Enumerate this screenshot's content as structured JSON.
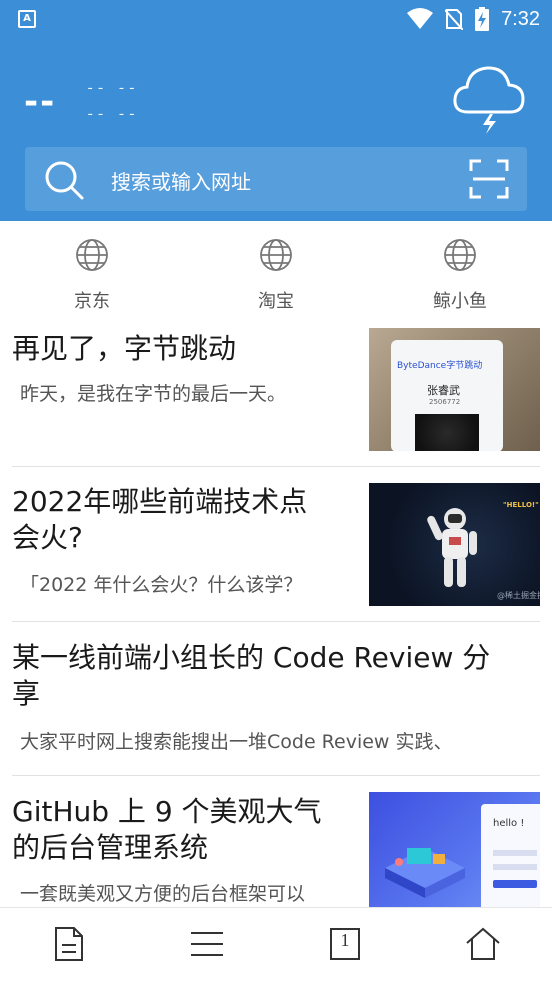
{
  "status": {
    "time": "7:32",
    "app_badge": "A"
  },
  "weather": {
    "temp": "--",
    "line1": "-- --",
    "line2": "-- --",
    "icon": "thunderstorm-cloud-icon"
  },
  "search": {
    "placeholder": "搜索或输入网址"
  },
  "quicklinks": [
    {
      "label": "京东",
      "icon": "globe-icon"
    },
    {
      "label": "淘宝",
      "icon": "globe-icon"
    },
    {
      "label": "鲸小鱼",
      "icon": "globe-icon"
    }
  ],
  "articles": [
    {
      "title_l1": "再见了，字节跳动",
      "title_l2": "",
      "summary": "昨天，是我在字节的最后一天。"
    },
    {
      "title_l1": "2022年哪些前端技术点",
      "title_l2": "会火?",
      "summary": "「2022 年什么会火？什么该学？"
    },
    {
      "title_l1": "某一线前端小组长的 Code Review 分",
      "title_l2": "享",
      "summary": "大家平时网上搜索能搜出一堆Code Review 实践、"
    },
    {
      "title_l1": "GitHub 上 9 个美观大气",
      "title_l2": "的后台管理系统",
      "summary": "一套既美观又方便的后台框架可以"
    }
  ],
  "thumbs": {
    "badge_brand": "ByteDance字节跳动",
    "badge_name": "张睿武",
    "badge_id": "2506772",
    "space_hello": "\"HELLO!\"",
    "space_watermark": "@稀土掘金技",
    "admin_hello": "hello !"
  },
  "colors": {
    "header": "#3c8fd7",
    "text": "#1a1a1a",
    "summary": "#555555"
  },
  "bottomnav": {
    "tab_count": "1"
  }
}
